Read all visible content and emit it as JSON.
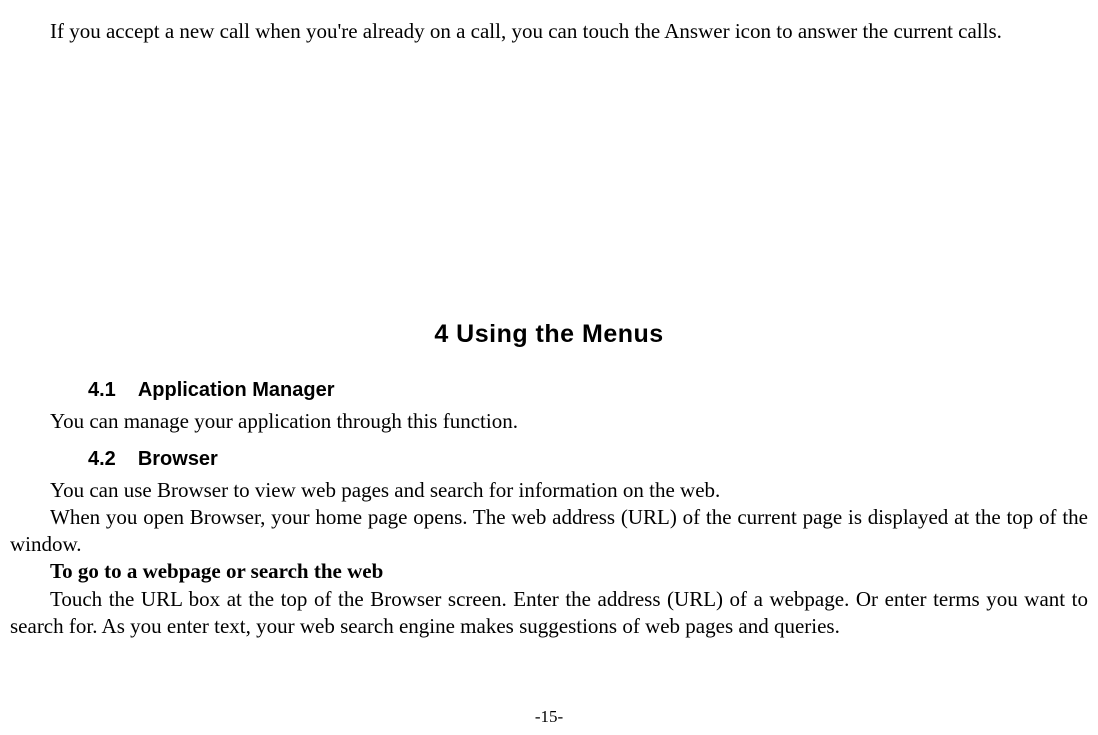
{
  "intro_paragraph": "If you accept a new call when you're already on a call, you can touch the Answer icon to answer the current calls.",
  "chapter_title": "4 Using the Menus",
  "sections": {
    "s41": {
      "num": "4.1",
      "title": "Application Manager",
      "body1": "You can manage your application through this function."
    },
    "s42": {
      "num": "4.2",
      "title": "Browser",
      "body1": "You can use Browser to view web pages and search for information on the web.",
      "body2": "When you open Browser, your home page opens. The web address (URL) of the current page is displayed at the top of the window.",
      "subhead": "To go to a webpage or search the web",
      "body3": "Touch the URL box at the top of the Browser screen. Enter the address (URL) of a webpage. Or enter terms you want to search for. As you enter text, your web search engine makes suggestions of web pages and queries."
    }
  },
  "page_number": "-15-"
}
